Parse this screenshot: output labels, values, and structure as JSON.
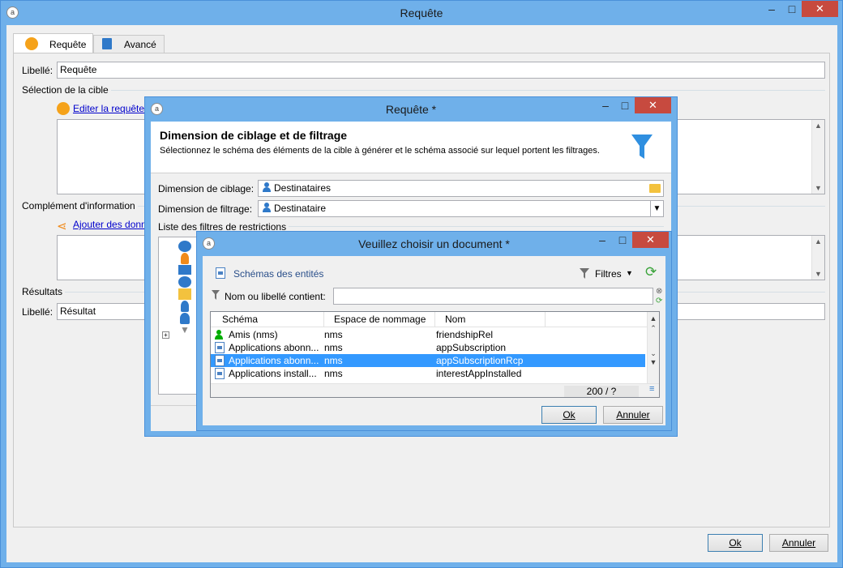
{
  "main_window": {
    "title": "Requête",
    "app_icon": "adobe-campaign-icon",
    "tabs": [
      {
        "label": "Requête",
        "icon": "orange-circle-icon"
      },
      {
        "label": "Avancé",
        "icon": "clipboard-icon"
      }
    ],
    "libelle_label": "Libellé:",
    "libelle_value": "Requête",
    "target_section": "Sélection de la cible",
    "edit_query_link": "Editer la requête...",
    "complement_section": "Complément d'information",
    "add_data_link": "Ajouter des données...",
    "results_section": "Résultats",
    "results_libelle_label": "Libellé:",
    "results_libelle_value": "Résultat",
    "ok_button": "Ok",
    "cancel_button": "Annuler"
  },
  "dialog1": {
    "title": "Requête *",
    "heading": "Dimension de ciblage et de filtrage",
    "description": "Sélectionnez le schéma des éléments de la cible à générer et le schéma associé sur lequel portent les filtrages.",
    "targeting_label": "Dimension de ciblage:",
    "targeting_value": "Destinataires",
    "filtering_label": "Dimension de filtrage:",
    "filtering_value": "Destinataire",
    "restrictions_label": "Liste des filtres de restrictions"
  },
  "dialog2": {
    "title": "Veuillez choisir un document *",
    "toolbar_label": "Schémas des entités",
    "filters_label": "Filtres",
    "search_label": "Nom ou libellé contient:",
    "search_value": "",
    "columns": [
      "Schéma",
      "Espace de nommage",
      "Nom"
    ],
    "rows": [
      {
        "schema": "Amis (nms)",
        "namespace": "nms",
        "name": "friendshipRel",
        "icon": "person-icon"
      },
      {
        "schema": "Applications abonn...",
        "namespace": "nms",
        "name": "appSubscription",
        "icon": "schema-doc-icon"
      },
      {
        "schema": "Applications abonn...",
        "namespace": "nms",
        "name": "appSubscriptionRcp",
        "icon": "schema-doc-icon",
        "selected": true
      },
      {
        "schema": "Applications install...",
        "namespace": "nms",
        "name": "interestAppInstalled",
        "icon": "schema-doc-icon"
      }
    ],
    "count": "200 / ?",
    "ok_button": "Ok",
    "cancel_button": "Annuler"
  },
  "colors": {
    "titlebar": "#6fb0ea",
    "close": "#c74a3f",
    "selection": "#3399ff",
    "accent_orange": "#f5a21a"
  }
}
